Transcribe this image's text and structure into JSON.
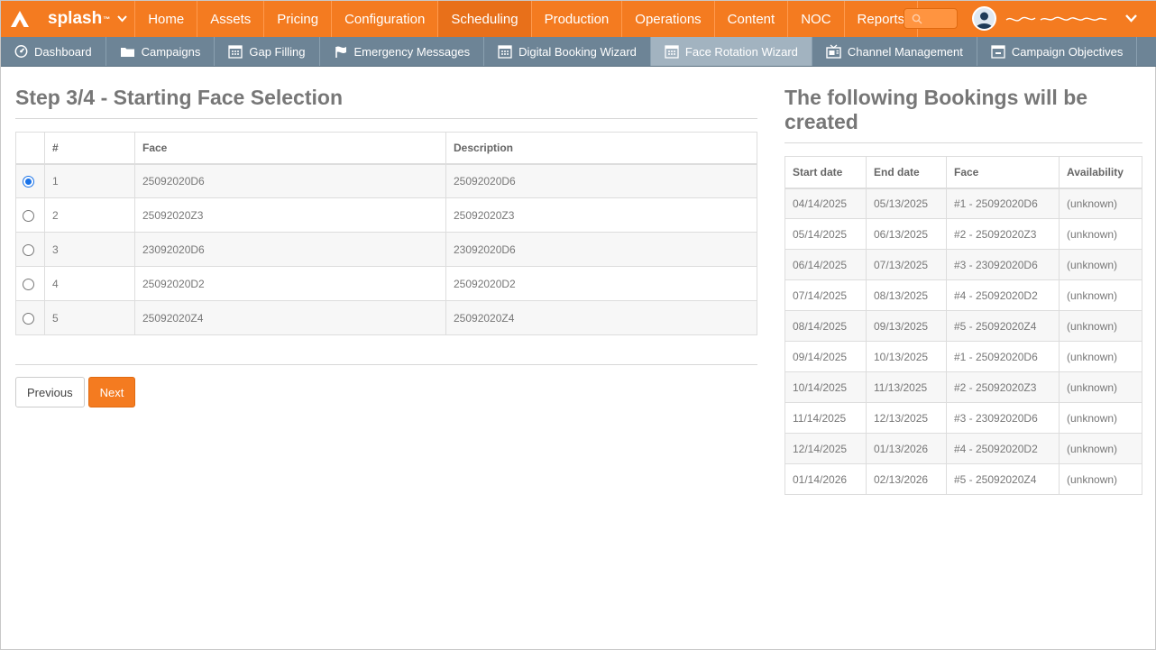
{
  "brand": {
    "name": "splash",
    "trademark": "™"
  },
  "colors": {
    "accent": "#f47b20",
    "subnav": "#6d8496",
    "radio_selected": "#1a73e8"
  },
  "topnav": {
    "items": [
      {
        "label": "Home"
      },
      {
        "label": "Assets"
      },
      {
        "label": "Pricing"
      },
      {
        "label": "Configuration"
      },
      {
        "label": "Scheduling"
      },
      {
        "label": "Production"
      },
      {
        "label": "Operations"
      },
      {
        "label": "Content"
      },
      {
        "label": "NOC"
      },
      {
        "label": "Reports"
      }
    ],
    "active": "Scheduling"
  },
  "subnav": {
    "items": [
      {
        "label": "Dashboard",
        "icon": "dashboard-icon"
      },
      {
        "label": "Campaigns",
        "icon": "folder-icon"
      },
      {
        "label": "Gap Filling",
        "icon": "calendar-icon"
      },
      {
        "label": "Emergency Messages",
        "icon": "flag-icon"
      },
      {
        "label": "Digital Booking Wizard",
        "icon": "calendar-icon"
      },
      {
        "label": "Face Rotation Wizard",
        "icon": "calendar-icon"
      },
      {
        "label": "Channel Management",
        "icon": "channel-icon"
      },
      {
        "label": "Campaign Objectives",
        "icon": "calendar-icon"
      }
    ],
    "active": "Face Rotation Wizard"
  },
  "step": {
    "title": "Step 3/4 - Starting Face Selection",
    "columns": [
      "#",
      "Face",
      "Description"
    ],
    "selected_index": 0,
    "rows": [
      {
        "num": "1",
        "face": "25092020D6",
        "description": "25092020D6"
      },
      {
        "num": "2",
        "face": "25092020Z3",
        "description": "25092020Z3"
      },
      {
        "num": "3",
        "face": "23092020D6",
        "description": "23092020D6"
      },
      {
        "num": "4",
        "face": "25092020D2",
        "description": "25092020D2"
      },
      {
        "num": "5",
        "face": "25092020Z4",
        "description": "25092020Z4"
      }
    ]
  },
  "buttons": {
    "previous": "Previous",
    "next": "Next"
  },
  "bookings": {
    "title": "The following Bookings will be created",
    "columns": [
      "Start date",
      "End date",
      "Face",
      "Availability"
    ],
    "rows": [
      {
        "start": "04/14/2025",
        "end": "05/13/2025",
        "face": "#1 - 25092020D6",
        "availability": "(unknown)"
      },
      {
        "start": "05/14/2025",
        "end": "06/13/2025",
        "face": "#2 - 25092020Z3",
        "availability": "(unknown)"
      },
      {
        "start": "06/14/2025",
        "end": "07/13/2025",
        "face": "#3 - 23092020D6",
        "availability": "(unknown)"
      },
      {
        "start": "07/14/2025",
        "end": "08/13/2025",
        "face": "#4 - 25092020D2",
        "availability": "(unknown)"
      },
      {
        "start": "08/14/2025",
        "end": "09/13/2025",
        "face": "#5 - 25092020Z4",
        "availability": "(unknown)"
      },
      {
        "start": "09/14/2025",
        "end": "10/13/2025",
        "face": "#1 - 25092020D6",
        "availability": "(unknown)"
      },
      {
        "start": "10/14/2025",
        "end": "11/13/2025",
        "face": "#2 - 25092020Z3",
        "availability": "(unknown)"
      },
      {
        "start": "11/14/2025",
        "end": "12/13/2025",
        "face": "#3 - 23092020D6",
        "availability": "(unknown)"
      },
      {
        "start": "12/14/2025",
        "end": "01/13/2026",
        "face": "#4 - 25092020D2",
        "availability": "(unknown)"
      },
      {
        "start": "01/14/2026",
        "end": "02/13/2026",
        "face": "#5 - 25092020Z4",
        "availability": "(unknown)"
      }
    ]
  }
}
